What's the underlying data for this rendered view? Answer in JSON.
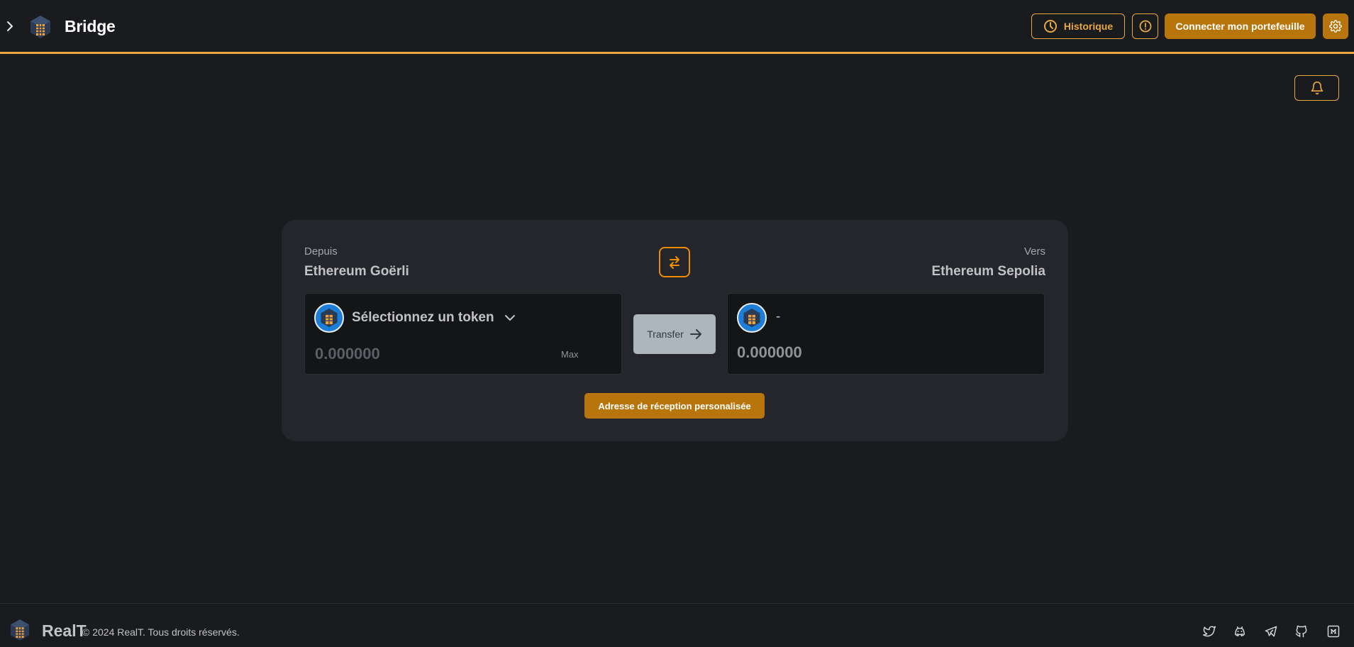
{
  "header": {
    "title": "Bridge",
    "history_label": "Historique",
    "connect_label": "Connecter mon portefeuille"
  },
  "bridge": {
    "from_label": "Depuis",
    "from_network": "Ethereum Goërli",
    "to_label": "Vers",
    "to_network": "Ethereum Sepolia",
    "token_select_label": "Sélectionnez un token",
    "amount_placeholder": "0.000000",
    "max_label": "Max",
    "transfer_label": "Transfer",
    "to_token": "-",
    "to_amount": "0.000000",
    "custom_address_label": "Adresse de réception personalisée"
  },
  "footer": {
    "brand": "RealT",
    "copyright": "© 2024 RealT. Tous droits réservés.",
    "social_icons": [
      "twitter-icon",
      "discord-icon",
      "telegram-icon",
      "github-icon",
      "medium-icon"
    ]
  },
  "colors": {
    "background": "#1a1b1e",
    "card": "#25262b",
    "accent": "#e8a840",
    "button": "#b8750b",
    "swap_border": "#f08c00"
  }
}
